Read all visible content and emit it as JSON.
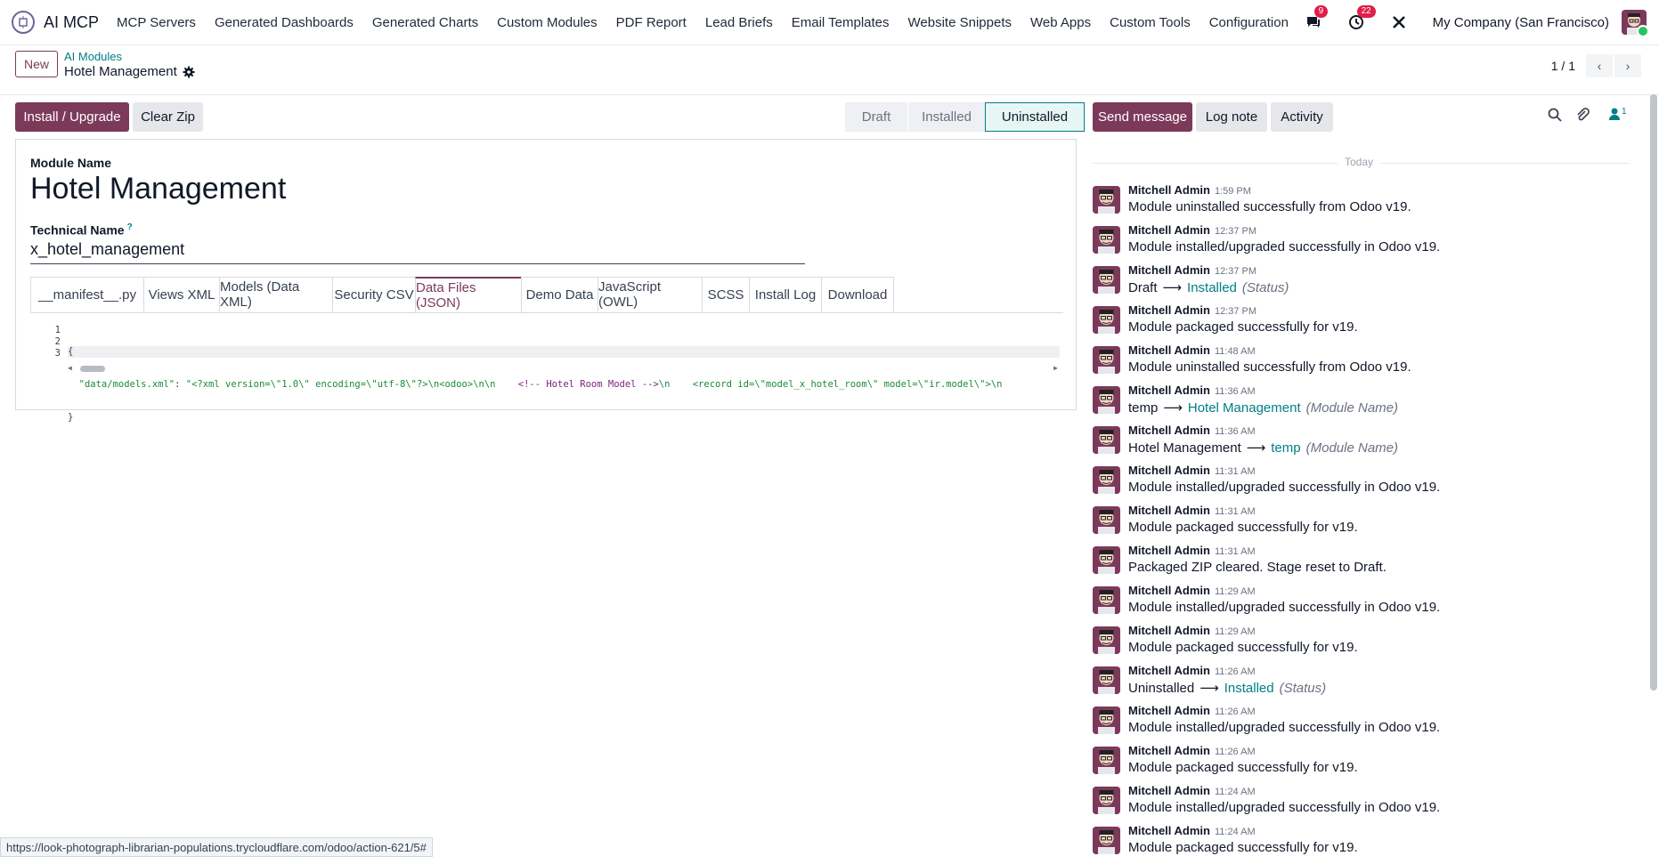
{
  "app": {
    "name": "AI MCP"
  },
  "menu": [
    "MCP Servers",
    "Generated Dashboards",
    "Generated Charts",
    "Custom Modules",
    "PDF Report",
    "Lead Briefs",
    "Email Templates",
    "Website Snippets",
    "Web Apps",
    "Custom Tools",
    "Configuration"
  ],
  "systray": {
    "messages_count": "9",
    "activities_count": "22",
    "company": "My Company (San Francisco)"
  },
  "control": {
    "new_label": "New",
    "breadcrumb_parent": "AI Modules",
    "breadcrumb_current": "Hotel Management",
    "pager": "1 / 1"
  },
  "form": {
    "install_label": "Install / Upgrade",
    "clear_label": "Clear Zip",
    "stages": [
      "Draft",
      "Installed",
      "Uninstalled"
    ],
    "active_stage": "Uninstalled",
    "module_name_label": "Module Name",
    "module_name": "Hotel Management",
    "technical_name_label": "Technical Name",
    "technical_help": "?",
    "technical_name": "x_hotel_management",
    "tabs": [
      "__manifest__.py",
      "Views XML",
      "Models (Data XML)",
      "Security CSV",
      "Data Files (JSON)",
      "Demo Data",
      "JavaScript (OWL)",
      "SCSS",
      "Install Log",
      "Download"
    ],
    "active_tab": "Data Files (JSON)",
    "code_gutter": [
      "1",
      "2",
      "3"
    ],
    "code_line1": "{",
    "code_line2_key": "  \"data/models.xml\"",
    "code_line2_sep": ": ",
    "code_line2_value_a": "\"<?xml version=\\\"1.0\\\" encoding=\\\"utf-8\\\"?>\\n<odoo>\\n\\n    ",
    "code_line2_value_b": "<!-- Hotel Room Model -->",
    "code_line2_value_c": "\\n    <record id=\\\"model_x_hotel_room\\\" model=\\\"ir.model\\\">\\n",
    "code_line3": "}"
  },
  "chatter": {
    "send_label": "Send message",
    "log_label": "Log note",
    "activity_label": "Activity",
    "followers_count": "1",
    "today_label": "Today",
    "messages": [
      {
        "author": "Mitchell Admin",
        "time": "1:59 PM",
        "body": "Module uninstalled successfully from Odoo v19."
      },
      {
        "author": "Mitchell Admin",
        "time": "12:37 PM",
        "body": "Module installed/upgraded successfully in Odoo v19."
      },
      {
        "author": "Mitchell Admin",
        "time": "12:37 PM",
        "old": "Draft",
        "new": "Installed",
        "field": "(Status)"
      },
      {
        "author": "Mitchell Admin",
        "time": "12:37 PM",
        "body": "Module packaged successfully for v19."
      },
      {
        "author": "Mitchell Admin",
        "time": "11:48 AM",
        "body": "Module uninstalled successfully from Odoo v19."
      },
      {
        "author": "Mitchell Admin",
        "time": "11:36 AM",
        "old": "temp",
        "new": "Hotel Management",
        "field": "(Module Name)"
      },
      {
        "author": "Mitchell Admin",
        "time": "11:36 AM",
        "old": "Hotel Management",
        "new": "temp",
        "field": "(Module Name)"
      },
      {
        "author": "Mitchell Admin",
        "time": "11:31 AM",
        "body": "Module installed/upgraded successfully in Odoo v19."
      },
      {
        "author": "Mitchell Admin",
        "time": "11:31 AM",
        "body": "Module packaged successfully for v19."
      },
      {
        "author": "Mitchell Admin",
        "time": "11:31 AM",
        "body": "Packaged ZIP cleared. Stage reset to Draft."
      },
      {
        "author": "Mitchell Admin",
        "time": "11:29 AM",
        "body": "Module installed/upgraded successfully in Odoo v19."
      },
      {
        "author": "Mitchell Admin",
        "time": "11:29 AM",
        "body": "Module packaged successfully for v19."
      },
      {
        "author": "Mitchell Admin",
        "time": "11:26 AM",
        "old": "Uninstalled",
        "new": "Installed",
        "field": "(Status)"
      },
      {
        "author": "Mitchell Admin",
        "time": "11:26 AM",
        "body": "Module installed/upgraded successfully in Odoo v19."
      },
      {
        "author": "Mitchell Admin",
        "time": "11:26 AM",
        "body": "Module packaged successfully for v19."
      },
      {
        "author": "Mitchell Admin",
        "time": "11:24 AM",
        "body": "Module installed/upgraded successfully in Odoo v19."
      },
      {
        "author": "Mitchell Admin",
        "time": "11:24 AM",
        "body": "Module packaged successfully for v19."
      }
    ]
  },
  "status_url": "https://look-photograph-librarian-populations.trycloudflare.com/odoo/action-621/5#",
  "colors": {
    "primary": "#7c3a5a",
    "teal": "#017e84"
  },
  "icons": [
    "app-icon",
    "chat-icon",
    "clock-icon",
    "tools-icon",
    "gear-icon",
    "chevron-left-icon",
    "chevron-right-icon",
    "search-icon",
    "paperclip-icon",
    "follower-icon",
    "user-avatar"
  ]
}
